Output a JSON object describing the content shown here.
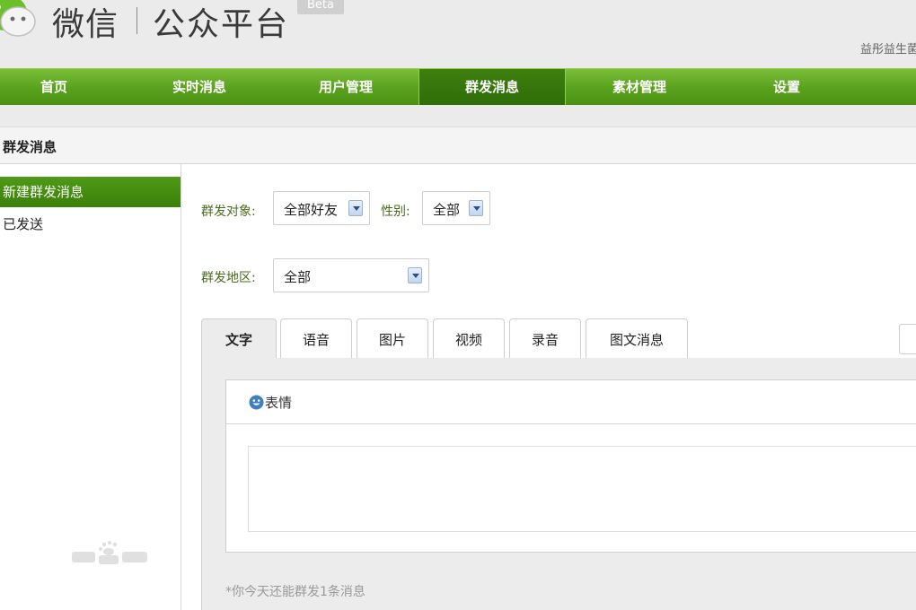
{
  "header": {
    "brand": "微信",
    "brand_sub": "公众平台",
    "badge": "Beta",
    "account": "益彤益生菌"
  },
  "nav": {
    "items": [
      {
        "label": "首页"
      },
      {
        "label": "实时消息"
      },
      {
        "label": "用户管理"
      },
      {
        "label": "群发消息",
        "active": true
      },
      {
        "label": "素材管理"
      },
      {
        "label": "设置"
      }
    ]
  },
  "page": {
    "title": "群发消息"
  },
  "sidebar": {
    "items": [
      {
        "label": "新建群发消息",
        "active": true
      },
      {
        "label": "已发送"
      }
    ]
  },
  "form": {
    "target_label": "群发对象:",
    "target_value": "全部好友",
    "gender_label": "性别:",
    "gender_value": "全部",
    "region_label": "群发地区:",
    "region_value": "全部"
  },
  "tabs": [
    {
      "label": "文字",
      "active": true
    },
    {
      "label": "语音"
    },
    {
      "label": "图片"
    },
    {
      "label": "视频"
    },
    {
      "label": "录音"
    },
    {
      "label": "图文消息"
    }
  ],
  "editor": {
    "emoji_label": "表情",
    "hint": "*你今天还能群发1条消息"
  },
  "colors": {
    "nav_green": "#58a11c",
    "nav_active": "#2f6d08",
    "label_green": "#4a6a1c"
  }
}
